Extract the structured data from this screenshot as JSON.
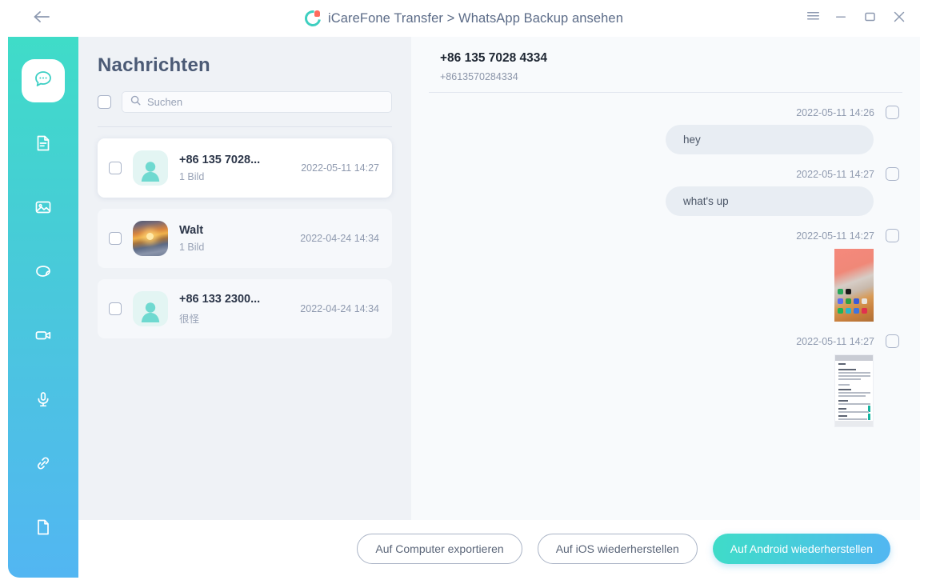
{
  "titlebar": {
    "back_icon": "arrow-left-icon",
    "brand_icon": "icarefone-logo-icon",
    "title": "iCareFone Transfer > WhatsApp Backup ansehen",
    "menu_icon": "hamburger-menu-icon",
    "minimize_icon": "minimize-icon",
    "maximize_icon": "maximize-icon",
    "close_icon": "close-icon"
  },
  "sidebar": {
    "gradient_from": "#3fdcc8",
    "gradient_to": "#52b6f2",
    "items": [
      {
        "icon": "chat-bubble-icon",
        "active": true
      },
      {
        "icon": "document-text-icon",
        "active": false
      },
      {
        "icon": "photo-image-icon",
        "active": false
      },
      {
        "icon": "sticker-icon",
        "active": false
      },
      {
        "icon": "video-camera-icon",
        "active": false
      },
      {
        "icon": "microphone-icon",
        "active": false
      },
      {
        "icon": "link-chain-icon",
        "active": false
      },
      {
        "icon": "file-blank-icon",
        "active": false
      }
    ]
  },
  "list_panel": {
    "title": "Nachrichten",
    "select_all_checked": false,
    "search": {
      "placeholder": "Suchen",
      "value": "",
      "icon": "search-icon"
    },
    "conversations": [
      {
        "name": "+86 135 7028...",
        "preview": "1 Bild",
        "time": "2022-05-11 14:27",
        "avatar": "person-placeholder-icon",
        "selected": true,
        "checked": false
      },
      {
        "name": "Walt",
        "preview": "1 Bild",
        "time": "2022-04-24 14:34",
        "avatar": "sunset-photo-thumbnail",
        "selected": false,
        "checked": false
      },
      {
        "name": "+86 133 2300...",
        "preview": "很怪",
        "time": "2022-04-24 14:34",
        "avatar": "person-placeholder-icon",
        "selected": false,
        "checked": false
      }
    ]
  },
  "chat_panel": {
    "contact_name": "+86 135 7028 4334",
    "contact_number": "+8613570284334",
    "messages": [
      {
        "time": "2022-05-11 14:26",
        "type": "text",
        "text": "hey",
        "checked": false
      },
      {
        "time": "2022-05-11 14:27",
        "type": "text",
        "text": "what's up",
        "checked": false
      },
      {
        "time": "2022-05-11 14:27",
        "type": "image",
        "image": "phone-home-screen-screenshot",
        "checked": false
      },
      {
        "time": "2022-05-11 14:27",
        "type": "image",
        "image": "document-page-screenshot",
        "checked": false
      }
    ]
  },
  "bottom_bar": {
    "export_label": "Auf Computer exportieren",
    "restore_ios_label": "Auf iOS wiederherstellen",
    "restore_android_label": "Auf Android wiederherstellen",
    "primary_color": "#45cfd8"
  }
}
